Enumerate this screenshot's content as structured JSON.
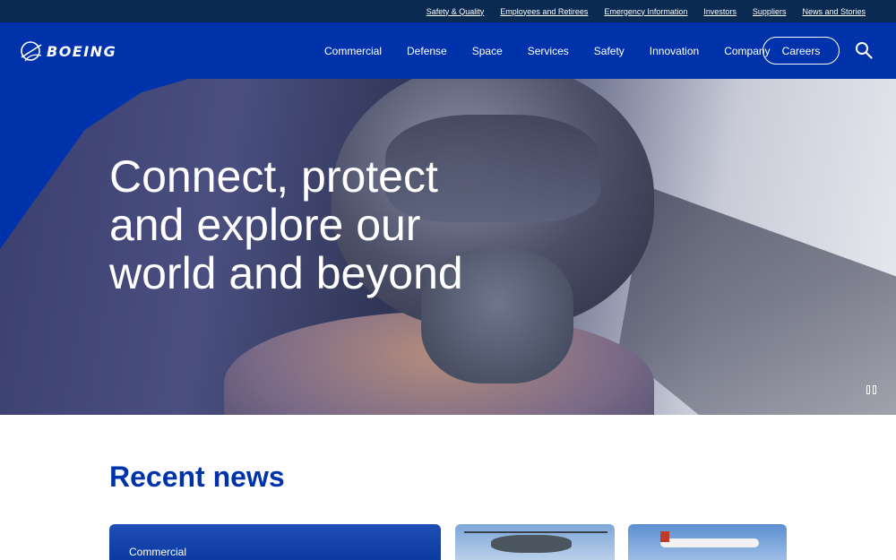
{
  "utility_links": [
    "Safety & Quality",
    "Employees and Retirees",
    "Emergency Information",
    "Investors",
    "Suppliers",
    "News and Stories"
  ],
  "logo": {
    "text": "BOEING",
    "icon": "boeing-logo-icon"
  },
  "nav": {
    "items": [
      "Commercial",
      "Defense",
      "Space",
      "Services",
      "Safety",
      "Innovation",
      "Company"
    ],
    "careers_label": "Careers",
    "search_icon": "search-icon"
  },
  "hero": {
    "headline": "Connect, protect and explore our world and beyond",
    "pause_icon": "pause-icon"
  },
  "news": {
    "title": "Recent news",
    "cards": [
      {
        "tag": "Commercial"
      }
    ]
  },
  "colors": {
    "brand_blue": "#0033ab",
    "utility_bar": "#0a2a52",
    "news_title": "#0033ab"
  }
}
